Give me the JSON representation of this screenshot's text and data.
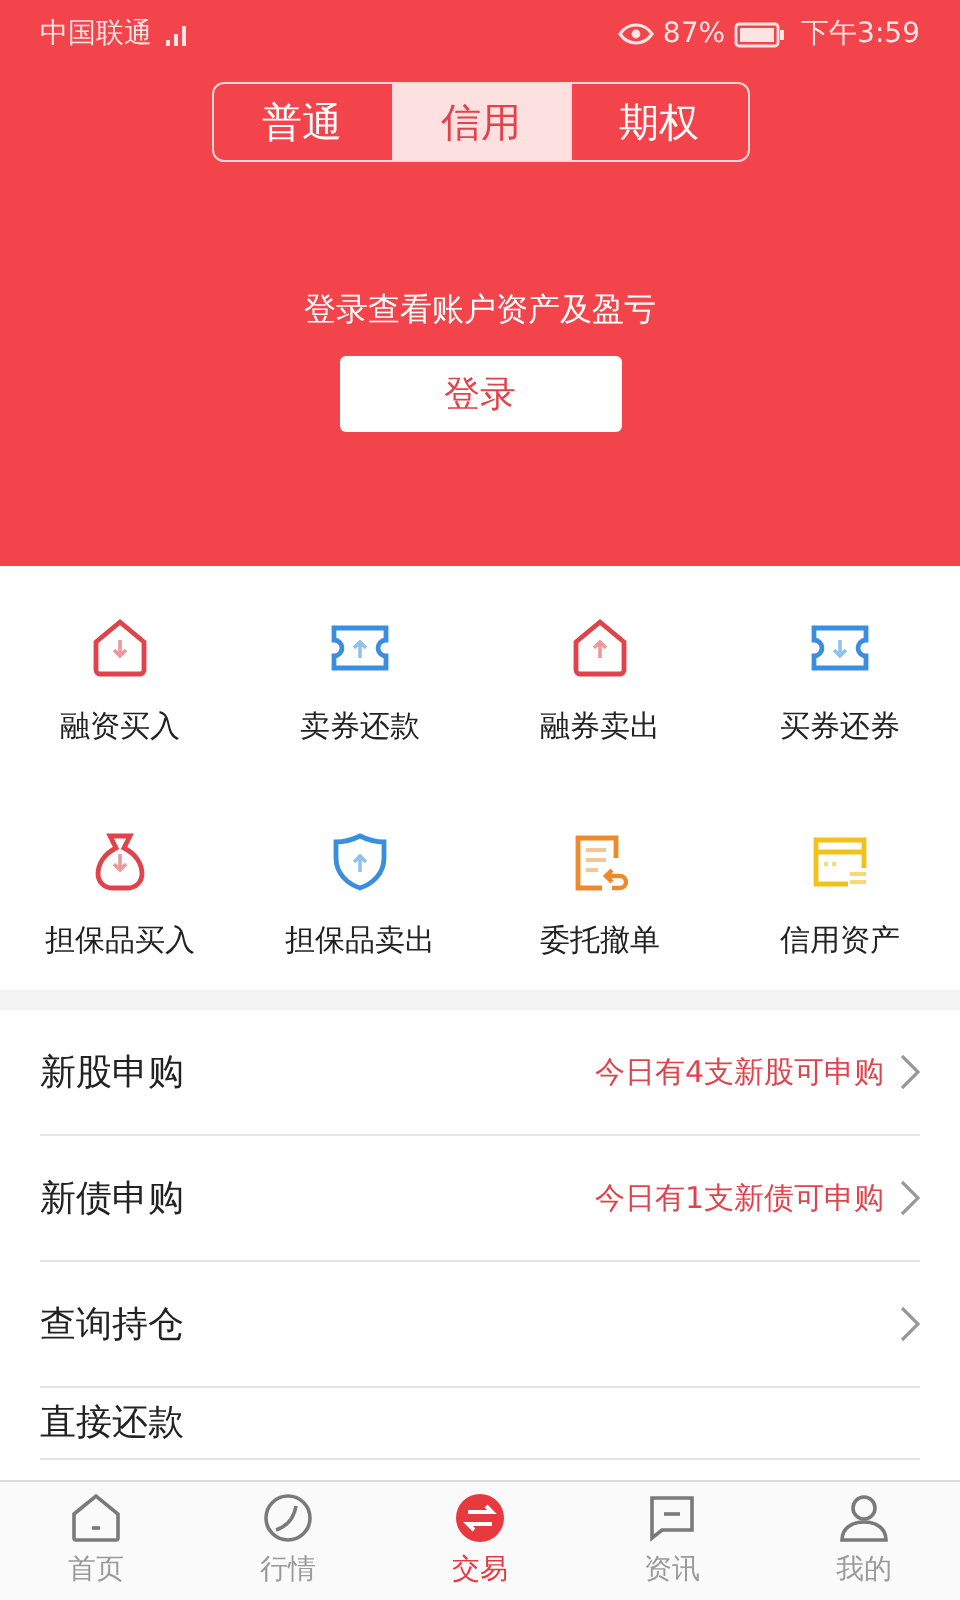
{
  "status_bar": {
    "carrier": "中国联通",
    "battery": "87%",
    "time": "下午3:59"
  },
  "tabs": [
    {
      "label": "普通",
      "selected": false
    },
    {
      "label": "信用",
      "selected": true
    },
    {
      "label": "期权",
      "selected": false
    }
  ],
  "banner": {
    "message": "登录查看账户资产及盈亏",
    "button": "登录"
  },
  "actions": [
    {
      "label": "融资买入"
    },
    {
      "label": "卖券还款"
    },
    {
      "label": "融券卖出"
    },
    {
      "label": "买券还券"
    },
    {
      "label": "担保品买入"
    },
    {
      "label": "担保品卖出"
    },
    {
      "label": "委托撤单"
    },
    {
      "label": "信用资产"
    }
  ],
  "list": [
    {
      "label": "新股申购",
      "note": "今日有4支新股可申购"
    },
    {
      "label": "新债申购",
      "note": "今日有1支新债可申购"
    },
    {
      "label": "查询持仓"
    },
    {
      "label": "直接还款"
    }
  ],
  "nav": [
    {
      "label": "首页",
      "selected": false
    },
    {
      "label": "行情",
      "selected": false
    },
    {
      "label": "交易",
      "selected": true
    },
    {
      "label": "资讯",
      "selected": false
    },
    {
      "label": "我的",
      "selected": false
    }
  ]
}
